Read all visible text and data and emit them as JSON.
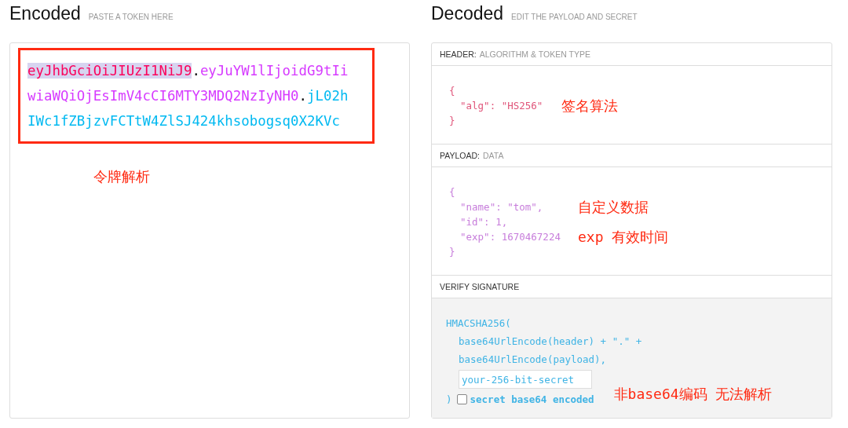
{
  "encoded": {
    "title": "Encoded",
    "subtitle": "PASTE A TOKEN HERE",
    "token": [
      {
        "kind": "header",
        "text": "eyJhbGciOiJIUzI1NiJ9",
        "highlighted": true
      },
      {
        "kind": "dot",
        "text": ".",
        "highlighted": false
      },
      {
        "kind": "payload",
        "text": "eyJuYW1lIjoidG9tIiwiaWQiOjEsImV4cCI6MTY3MDQ2NzIyNH0",
        "highlighted": false
      },
      {
        "kind": "dot",
        "text": ".",
        "highlighted": false
      },
      {
        "kind": "signature",
        "text": "jL02hIWc1fZBjzvFCTtW4ZlSJ424khsobogsq0X2KVc",
        "highlighted": false
      }
    ],
    "note": "令牌解析"
  },
  "decoded": {
    "title": "Decoded",
    "subtitle": "EDIT THE PAYLOAD AND SECRET",
    "sections": [
      {
        "kind": "header",
        "label": "HEADER:",
        "sublabel": "ALGORITHM & TOKEN TYPE",
        "open": "{",
        "entries": [
          {
            "text": "\"alg\": \"HS256\"",
            "note": "签名算法"
          }
        ],
        "close": "}"
      },
      {
        "kind": "payload",
        "label": "PAYLOAD:",
        "sublabel": "DATA",
        "open": "{",
        "entries": [
          {
            "text": "\"name\": \"tom\",",
            "note": "自定义数据"
          },
          {
            "text": "\"id\": 1,"
          },
          {
            "text": "\"exp\": 1670467224",
            "note": "exp 有效时间"
          }
        ],
        "close": "}"
      }
    ],
    "verify": {
      "label": "VERIFY SIGNATURE",
      "call": "HMACSHA256(",
      "args": [
        "base64UrlEncode(header) + \".\" +",
        "base64UrlEncode(payload),"
      ],
      "secret": "your-256-bit-secret",
      "close": ")",
      "checkbox": {
        "label": "secret base64 encoded",
        "checked": false
      },
      "note": "非base64编码 无法解析"
    }
  }
}
